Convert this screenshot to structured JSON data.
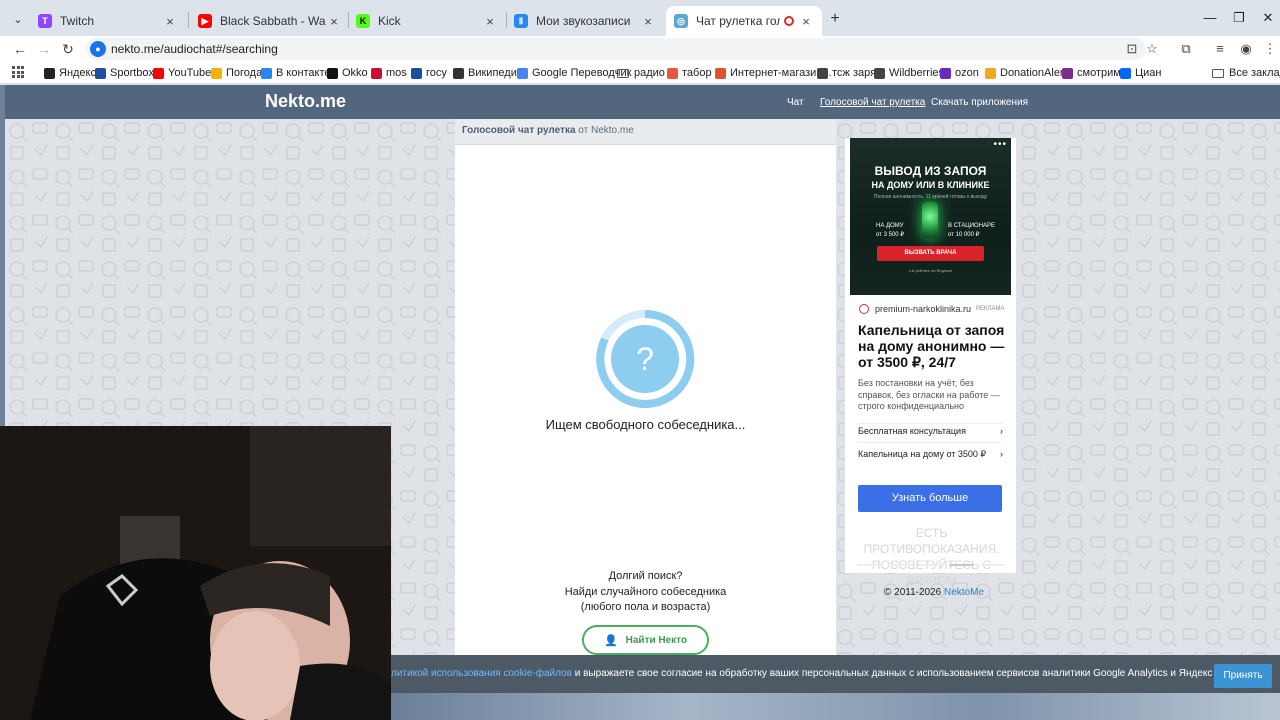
{
  "browser": {
    "tabs": [
      {
        "title": "Twitch",
        "color": "#9146ff",
        "glyph": "T",
        "active": false
      },
      {
        "title": "Black Sabbath - War Pigs - You",
        "color": "#ff0000",
        "glyph": "▶",
        "active": false
      },
      {
        "title": "Kick",
        "color": "#53fc18",
        "glyph": "K",
        "active": false
      },
      {
        "title": "Мои звукозаписи",
        "color": "#2787f5",
        "glyph": "Ⅱ",
        "active": false
      },
      {
        "title": "Чат рулетка голосовая —",
        "color": "#5aa7d6",
        "glyph": "◎",
        "active": true
      }
    ],
    "new_tab": "+",
    "url": "nekto.me/audiochat#/searching",
    "bookmarks": [
      {
        "label": "Яндекс",
        "color": "#222"
      },
      {
        "label": "Sportbox",
        "color": "#1d4fa3"
      },
      {
        "label": "YouTube",
        "color": "#ff0000"
      },
      {
        "label": "Погода",
        "color": "#f5b400"
      },
      {
        "label": "В контакте",
        "color": "#2787f5"
      },
      {
        "label": "Okko",
        "color": "#111"
      },
      {
        "label": "mos",
        "color": "#c8102e"
      },
      {
        "label": "госу",
        "color": "#1b4fa0"
      },
      {
        "label": "Википедия",
        "color": "#333"
      },
      {
        "label": "Google Переводчик",
        "color": "#4285f4"
      },
      {
        "label": "радио",
        "color": "folder"
      },
      {
        "label": "табор",
        "color": "#e8583a"
      },
      {
        "label": "Интернет-магазин...",
        "color": "#e0522a"
      },
      {
        "label": "тсж заря",
        "color": "#444"
      },
      {
        "label": "Wildberries",
        "color": "#444"
      },
      {
        "label": "ozon",
        "color": "#6a2bbd"
      },
      {
        "label": "DonationAlerts",
        "color": "#f5a623"
      },
      {
        "label": "смотрим",
        "color": "#7b2d8e"
      },
      {
        "label": "Циан",
        "color": "#0468ff"
      }
    ],
    "all_bookmarks": "Все закладки"
  },
  "site": {
    "logo": "Nekto.me",
    "nav": [
      "Чат",
      "Голосовой чат рулетка",
      "Скачать приложения"
    ]
  },
  "chat": {
    "head_bold": "Голосовой чат рулетка",
    "head_rest": " от Nekto.me",
    "spinner_glyph": "?",
    "searching": "Ищем свободного собеседника...",
    "long_search_1": "Долгий поиск?",
    "long_search_2": "Найди случайного собеседника",
    "long_search_3": "(любого пола и возраста)",
    "find_button": "Найти Некто"
  },
  "ad": {
    "banner_title": "ВЫВОД ИЗ ЗАПОЯ",
    "banner_subtitle": "НА ДОМУ ИЛИ В КЛИНИКЕ",
    "banner_note": "Полная анонимность. 11 врачей готовы к выезду",
    "price_home_label": "НА ДОМУ",
    "price_home": "от 3 500 ₽",
    "price_clinic_label": "В СТАЦИОНАРЕ",
    "price_clinic": "от 10 000 ₽",
    "banner_cta": "ВЫЗВАТЬ ВРАЧА",
    "banner_rating": "4.8 рейтинг на Яндексе",
    "domain": "premium-narkoklinika.ru",
    "tag": "РЕКЛАМА",
    "title": "Капельница от запоя на дому анонимно — от 3500 ₽, 24/7",
    "desc": "Без постановки на учёт, без справок, без огласки на работе — строго конфиденциально",
    "link1": "Бесплатная консультация",
    "link2": "Капельница на дому от 3500 ₽",
    "button": "Узнать больше",
    "warning": "ЕСТЬ ПРОТИВОПОКАЗАНИЯ. ПОСОВЕТУЙТЕСЬ С ВРАЧОМ"
  },
  "footer": {
    "copyright": "© 2011-2026 ",
    "brand": "NektoMe"
  },
  "cookie": {
    "link_text": "литикой использования cookie-файлов",
    "text": " и выражаете свое согласие на обработку ваших персональных данных с использованием сервисов аналитики Google Analytics и Яндекс Метрика.",
    "accept": "Принять"
  }
}
